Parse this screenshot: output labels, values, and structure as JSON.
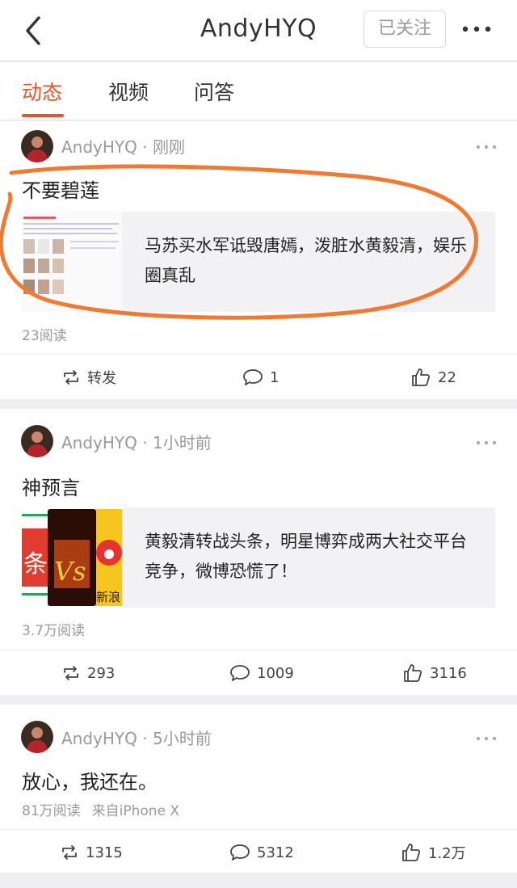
{
  "header": {
    "title": "AndyHYQ",
    "follow_label": "已关注"
  },
  "tabs": [
    {
      "label": "动态"
    },
    {
      "label": "视频"
    },
    {
      "label": "问答"
    }
  ],
  "accent_color": "#e8542a",
  "annotation_color": "#f07a32",
  "posts": [
    {
      "author": "AndyHYQ",
      "separator": "·",
      "time": "刚刚",
      "text": "不要碧莲",
      "link_title": "马苏买水军诋毁唐嫣，泼脏水黄毅清，娱乐圈真乱",
      "reads": "23阅读",
      "source": "",
      "repost": "转发",
      "comments": "1",
      "likes": "22"
    },
    {
      "author": "AndyHYQ",
      "separator": "·",
      "time": "1小时前",
      "text": "神预言",
      "link_title": "黄毅清转战头条，明星博弈成两大社交平台竞争，微博恐慌了！",
      "thumb_text_left": "条",
      "thumb_text_right": "新浪",
      "thumb_vs": "Vs",
      "reads": "3.7万阅读",
      "source": "",
      "repost": "293",
      "comments": "1009",
      "likes": "3116"
    },
    {
      "author": "AndyHYQ",
      "separator": "·",
      "time": "5小时前",
      "text": "放心，我还在。",
      "reads": "81万阅读",
      "source": "来自iPhone X",
      "repost": "1315",
      "comments": "5312",
      "likes": "1.2万"
    }
  ]
}
